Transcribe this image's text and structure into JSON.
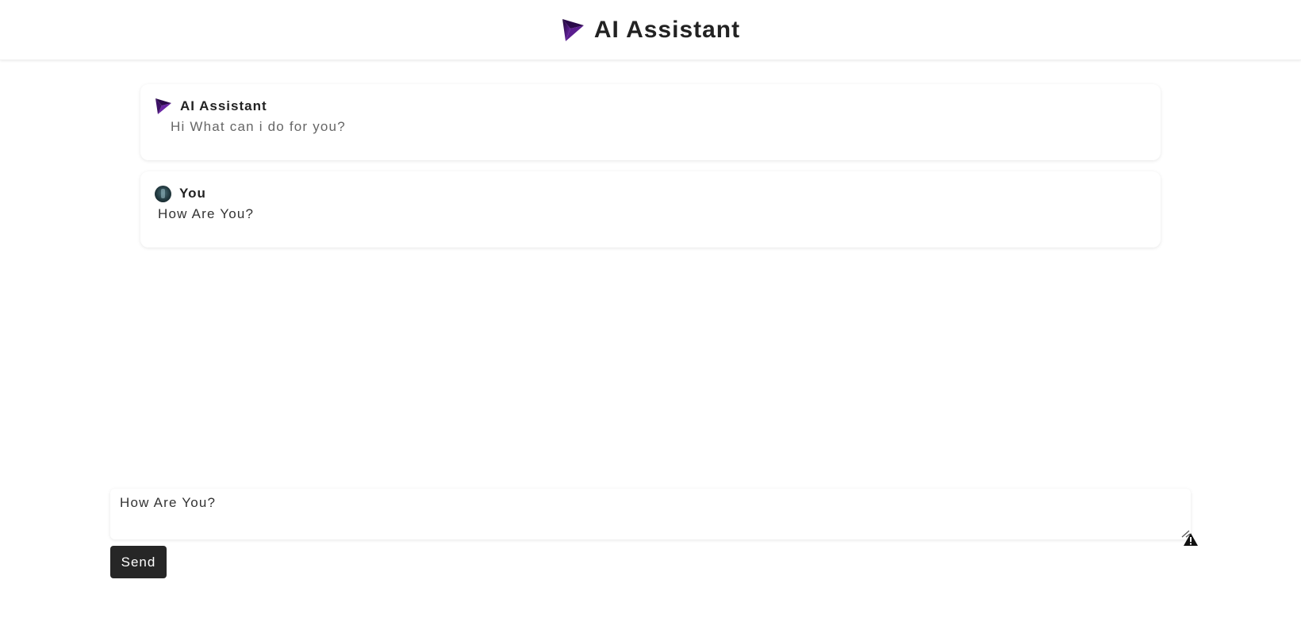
{
  "header": {
    "title": "AI Assistant",
    "logo_icon": "paper-plane-icon",
    "logo_color": "#4b0f7a"
  },
  "messages": [
    {
      "sender": "AI Assistant",
      "text": "Hi What can i do for you?",
      "icon": "paper-plane-icon"
    },
    {
      "sender": "You",
      "text": "How Are You?",
      "icon": "user-avatar"
    }
  ],
  "composer": {
    "value": "How Are You?",
    "send_label": "Send",
    "warning_icon": "warning-icon"
  },
  "colors": {
    "accent": "#4b0f7a",
    "button_bg": "#262626",
    "button_text": "#ffffff"
  }
}
